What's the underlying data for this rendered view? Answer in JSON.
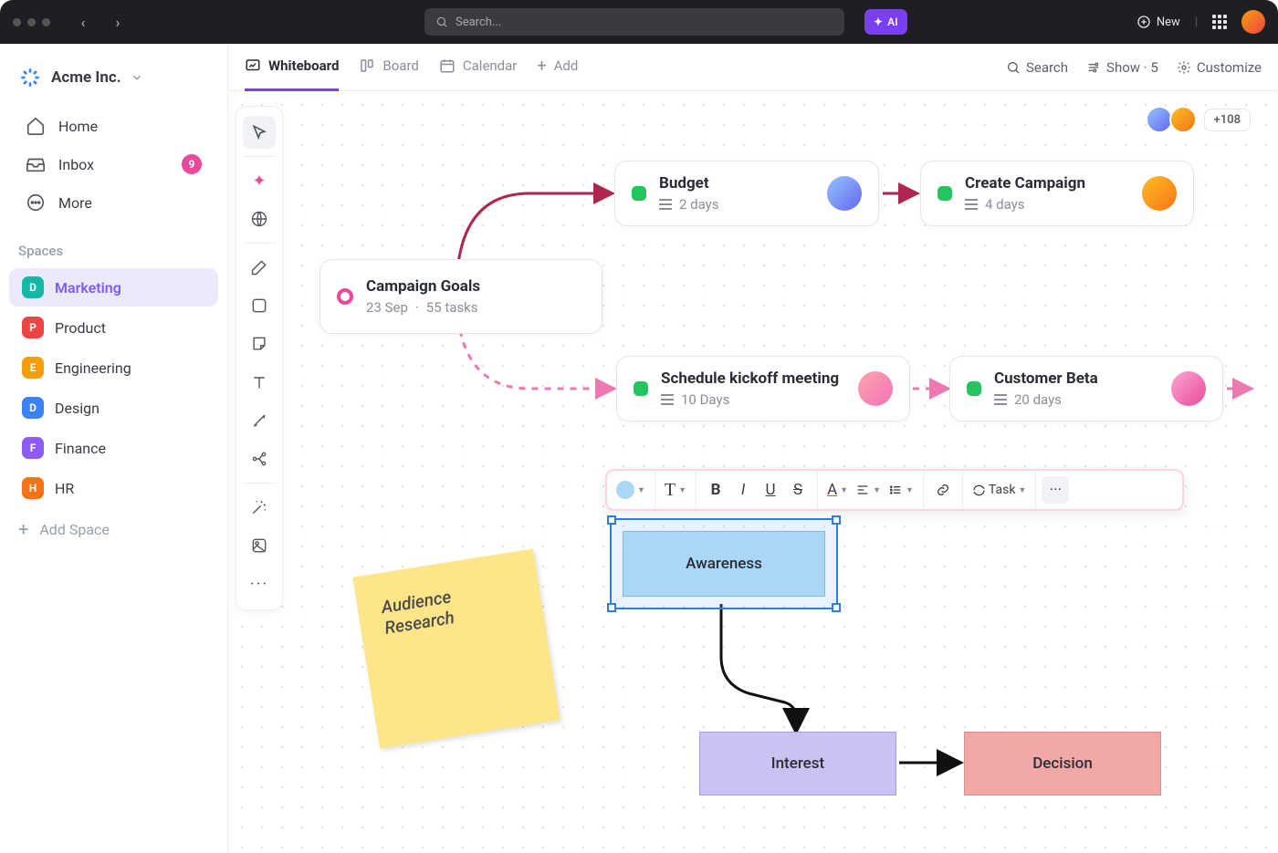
{
  "topbar": {
    "search_placeholder": "Search...",
    "ai_label": "AI",
    "new_label": "New"
  },
  "workspace": {
    "name": "Acme Inc."
  },
  "sidebar": {
    "items": [
      {
        "label": "Home",
        "icon": "home"
      },
      {
        "label": "Inbox",
        "icon": "inbox",
        "badge": "9"
      },
      {
        "label": "More",
        "icon": "more"
      }
    ],
    "spaces_label": "Spaces",
    "spaces": [
      {
        "letter": "D",
        "label": "Marketing",
        "color": "#14b8a6",
        "active": true
      },
      {
        "letter": "P",
        "label": "Product",
        "color": "#ef4444"
      },
      {
        "letter": "E",
        "label": "Engineering",
        "color": "#f59e0b"
      },
      {
        "letter": "D",
        "label": "Design",
        "color": "#3b82f6"
      },
      {
        "letter": "F",
        "label": "Finance",
        "color": "#8b5cf6"
      },
      {
        "letter": "H",
        "label": "HR",
        "color": "#f97316"
      }
    ],
    "add_space_label": "Add Space"
  },
  "tabs": {
    "items": [
      {
        "label": "Whiteboard",
        "icon": "whiteboard",
        "active": true
      },
      {
        "label": "Board",
        "icon": "board"
      },
      {
        "label": "Calendar",
        "icon": "calendar"
      },
      {
        "label": "Add",
        "icon": "plus"
      }
    ],
    "right": {
      "search": "Search",
      "show": "Show · 5",
      "customize": "Customize"
    }
  },
  "presence": {
    "extra": "+108"
  },
  "cards": {
    "goals": {
      "title": "Campaign Goals",
      "date": "23 Sep",
      "tasks": "55 tasks"
    },
    "budget": {
      "title": "Budget",
      "meta": "2 days"
    },
    "campaign": {
      "title": "Create Campaign",
      "meta": "4 days"
    },
    "kickoff": {
      "title": "Schedule kickoff meeting",
      "meta": "10 Days"
    },
    "beta": {
      "title": "Customer Beta",
      "meta": "20 days"
    }
  },
  "sticky": {
    "text": "Audience Research"
  },
  "shapes": {
    "awareness": "Awareness",
    "interest": "Interest",
    "decision": "Decision"
  },
  "rt": {
    "task_label": "Task"
  }
}
